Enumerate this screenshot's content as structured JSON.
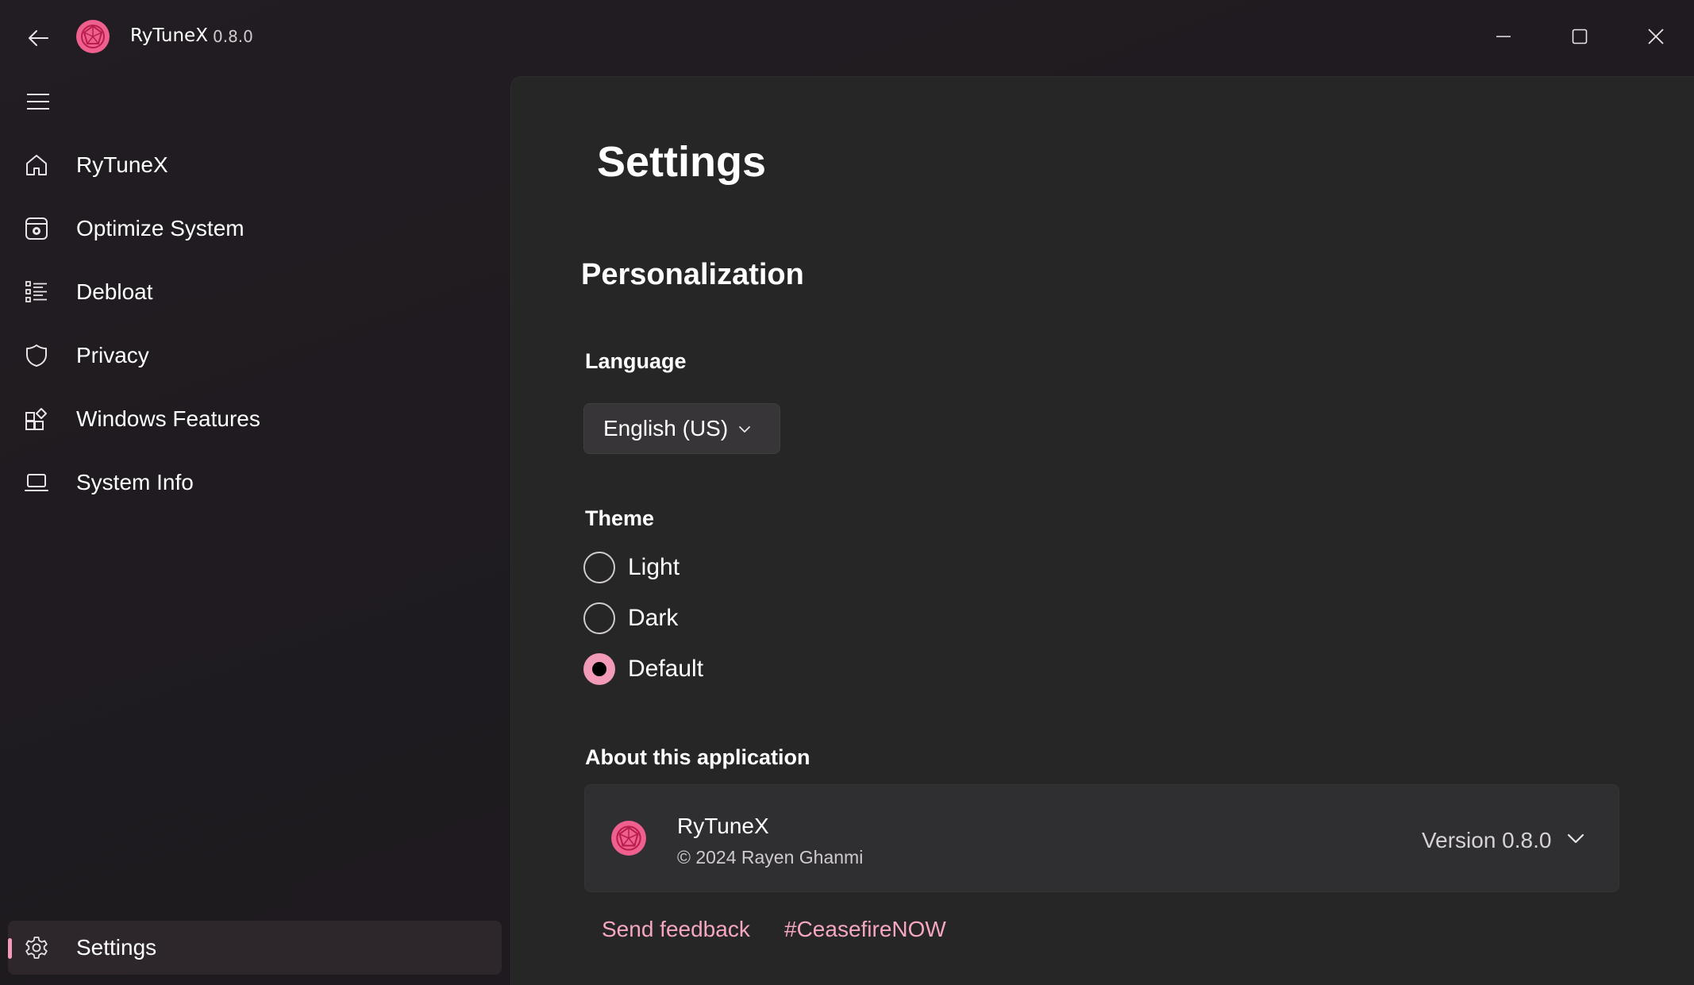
{
  "window": {
    "app_name": "RyTuneX",
    "app_version": "0.8.0",
    "accent": "#f29bb8",
    "link_color": "#f4a6c2"
  },
  "titlebar": {
    "back_icon": "arrow-left-icon",
    "minimize_icon": "minimize-icon",
    "maximize_icon": "maximize-icon",
    "close_icon": "close-icon"
  },
  "sidebar": {
    "menu_icon": "hamburger-menu-icon",
    "items": [
      {
        "label": "RyTuneX",
        "icon": "home-icon"
      },
      {
        "label": "Optimize System",
        "icon": "optimize-icon"
      },
      {
        "label": "Debloat",
        "icon": "list-icon"
      },
      {
        "label": "Privacy",
        "icon": "shield-icon"
      },
      {
        "label": "Windows Features",
        "icon": "apps-add-icon"
      },
      {
        "label": "System Info",
        "icon": "laptop-icon"
      }
    ],
    "footer_item": {
      "label": "Settings",
      "icon": "gear-icon",
      "selected": true
    }
  },
  "main": {
    "page_title": "Settings",
    "section_title": "Personalization",
    "language": {
      "label": "Language",
      "selected": "English (US)"
    },
    "theme": {
      "label": "Theme",
      "options": [
        "Light",
        "Dark",
        "Default"
      ],
      "selected": "Default"
    },
    "about": {
      "label": "About this application",
      "app_name": "RyTuneX",
      "copyright": "© 2024 Rayen Ghanmi",
      "version": "Version 0.8.0"
    },
    "links": {
      "feedback": "Send feedback",
      "hashtag": "#CeasefireNOW"
    }
  }
}
